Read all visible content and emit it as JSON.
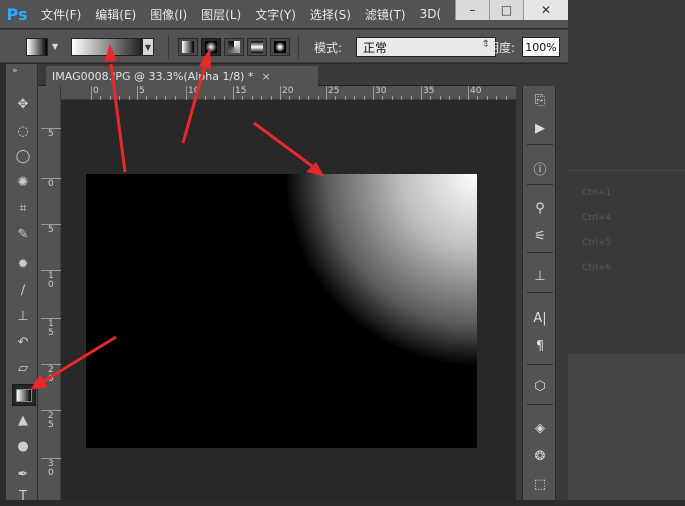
{
  "app": {
    "logo": "Ps",
    "menu": [
      "文件(F)",
      "编辑(E)",
      "图像(I)",
      "图层(L)",
      "文字(Y)",
      "选择(S)",
      "滤镜(T)",
      "3D("
    ],
    "window_buttons": [
      "–",
      "□",
      "✕"
    ]
  },
  "options": {
    "mode_label": "模式:",
    "mode_value": "正常",
    "opacity_label": "不透明度:",
    "opacity_value": "100%",
    "gradient_types": [
      "linear-gradient-icon",
      "radial-gradient-icon",
      "angle-gradient-icon",
      "reflected-gradient-icon",
      "diamond-gradient-icon"
    ],
    "active_gradient_type": "radial-gradient-icon"
  },
  "document": {
    "tab_title": "IMAG0008.JPG @ 33.3%(Alpha 1/8) *",
    "close_glyph": "×"
  },
  "ruler": {
    "top_labels": [
      "0",
      "5",
      "10",
      "15",
      "20",
      "25",
      "30",
      "35",
      "40"
    ],
    "left_labels": [
      "5",
      "0",
      "5",
      "1 0",
      "1 5",
      "2 0",
      "2 5",
      "3 0"
    ]
  },
  "panel_faded_shortcuts": [
    "Ctrl+1",
    "Ctrl+4",
    "Ctrl+5",
    "Ctrl+6"
  ],
  "colors": {
    "menubar": "#535353",
    "logo": "#31a8ff",
    "canvas": "#000000",
    "arrow": "#e8282a"
  }
}
